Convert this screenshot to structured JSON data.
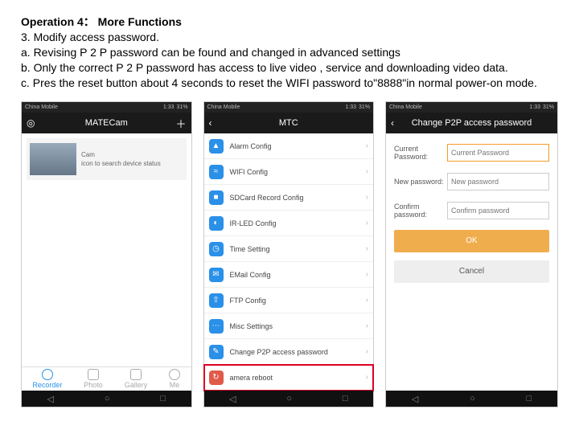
{
  "heading": "Operation 4： More Functions",
  "line3": "3. Modify access password.",
  "line_a": "a. Revising P 2 P password can be found and changed in advanced settings",
  "line_b": "b. Only the correct P 2 P password has access to live video , service and downloading video data.",
  "line_c": "c. Pres the reset button about 4 seconds to reset the WIFI password to\"8888\"in normal power-on mode.",
  "status": {
    "carrier": "China Mobile",
    "time": "1:33",
    "batt": "31%"
  },
  "screen1": {
    "title": "MATECam",
    "device_name": "Cam",
    "device_sub": "icon to search device status",
    "tabs": [
      "Recorder",
      "Photo",
      "Gallery",
      "Me"
    ]
  },
  "screen2": {
    "title": "MTC",
    "rows": [
      {
        "color": "c-blue",
        "icon": "▲",
        "label": "Alarm Config"
      },
      {
        "color": "c-blue",
        "icon": "≈",
        "label": "WIFI Config"
      },
      {
        "color": "c-blue",
        "icon": "■",
        "label": "SDCard Record Config"
      },
      {
        "color": "c-blue",
        "icon": "◐",
        "label": "IR-LED Config"
      },
      {
        "color": "c-blue",
        "icon": "◷",
        "label": "Time Setting"
      },
      {
        "color": "c-blue",
        "icon": "✉",
        "label": "EMail Config"
      },
      {
        "color": "c-blue",
        "icon": "⇧",
        "label": "FTP Config"
      },
      {
        "color": "c-blue",
        "icon": "⋯",
        "label": "Misc Settings"
      },
      {
        "color": "c-blue",
        "icon": "✎",
        "label": "Change P2P access password"
      },
      {
        "color": "c-red",
        "icon": "↻",
        "label": "amera reboot",
        "highlight": true
      }
    ]
  },
  "screen3": {
    "title": "Change P2P access password",
    "fields": {
      "current_label": "Current Password:",
      "current_ph": "Current Password",
      "new_label": "New password:",
      "new_ph": "New password",
      "confirm_label": "Confirm password:",
      "confirm_ph": "Confirm password"
    },
    "ok": "OK",
    "cancel": "Cancel"
  }
}
